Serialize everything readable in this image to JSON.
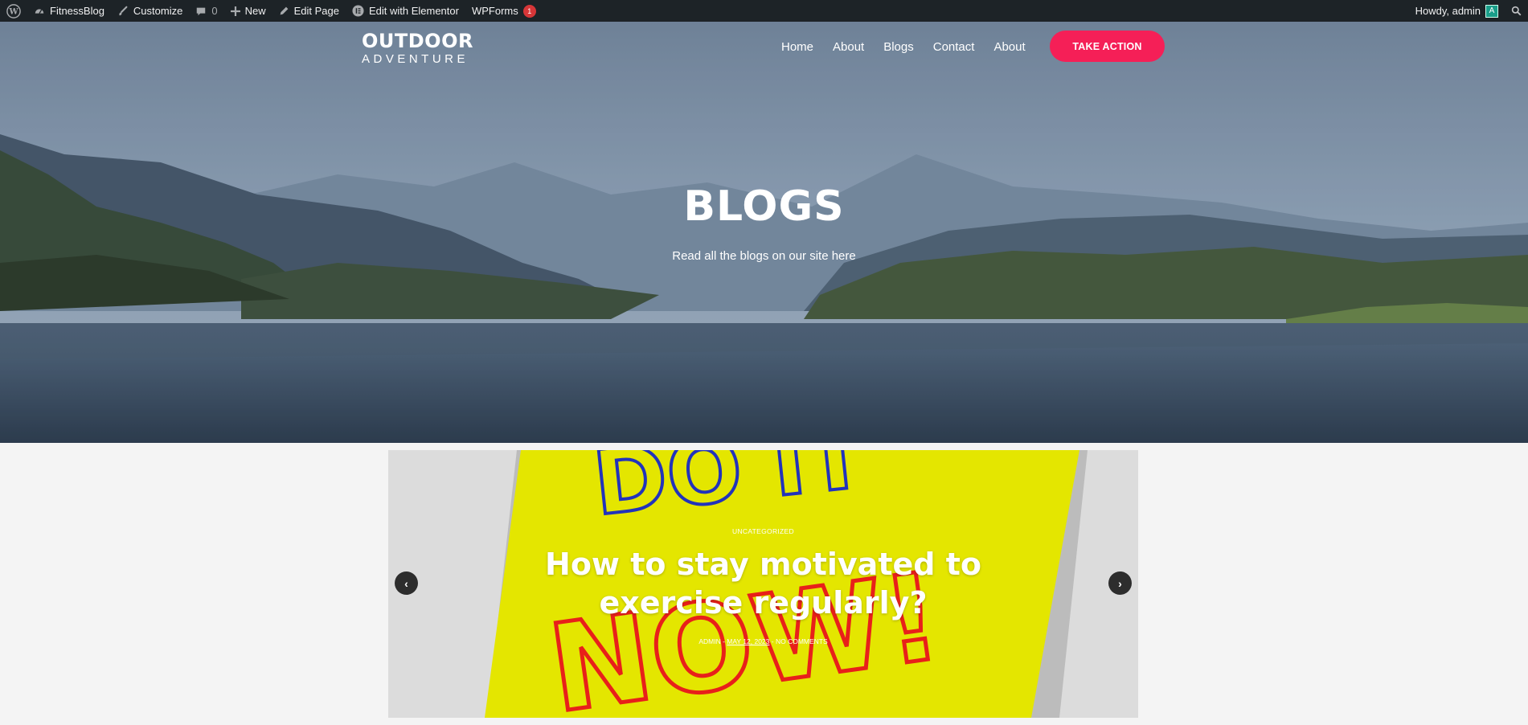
{
  "adminbar": {
    "site_name": "FitnessBlog",
    "customize": "Customize",
    "comments_count": "0",
    "new": "New",
    "edit_page": "Edit Page",
    "edit_elementor": "Edit with Elementor",
    "wpforms": "WPForms",
    "wpforms_badge": "1",
    "howdy": "Howdy, admin",
    "avatar_letter": "A"
  },
  "header": {
    "logo_line1": "OUTDOOR",
    "logo_line2": "ADVENTURE",
    "nav": [
      "Home",
      "About",
      "Blogs",
      "Contact",
      "About"
    ],
    "cta": "TAKE ACTION"
  },
  "hero": {
    "title": "BLOGS",
    "subtitle": "Read all the blogs on our site here"
  },
  "slider": {
    "category": "UNCATEGORIZED",
    "title": "How to stay motivated to exercise regularly?",
    "author": "ADMIN",
    "date": "MAY 12, 2023",
    "comments": "NO COMMENTS",
    "image_text_top": "DO IT",
    "image_text_bottom": "NOW!"
  },
  "colors": {
    "admin_bar": "#1d2327",
    "cta": "#f51f57",
    "slide_yellow": "#e4e600"
  }
}
